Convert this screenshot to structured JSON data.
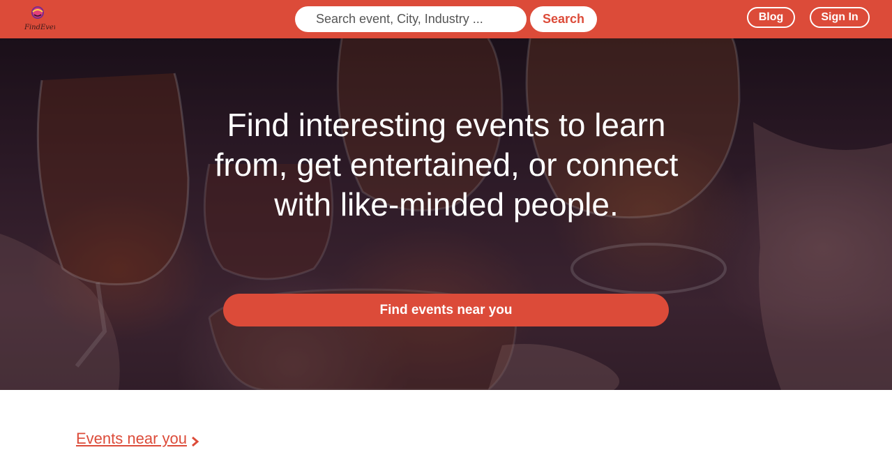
{
  "header": {
    "search_placeholder": "Search event, City, Industry ...",
    "search_button": "Search",
    "blog_label": "Blog",
    "signin_label": "Sign In",
    "logo_text": "FindEvent"
  },
  "hero": {
    "title": "Find interesting events to learn from, get entertained, or connect with like-minded people.",
    "cta_label": "Find events near you"
  },
  "events_section": {
    "link_label": "Events near you"
  },
  "colors": {
    "accent": "#dc4b39",
    "white": "#ffffff"
  },
  "icons": {
    "logo": "findevent-logo-icon",
    "chevron": "chevron-right-icon"
  }
}
